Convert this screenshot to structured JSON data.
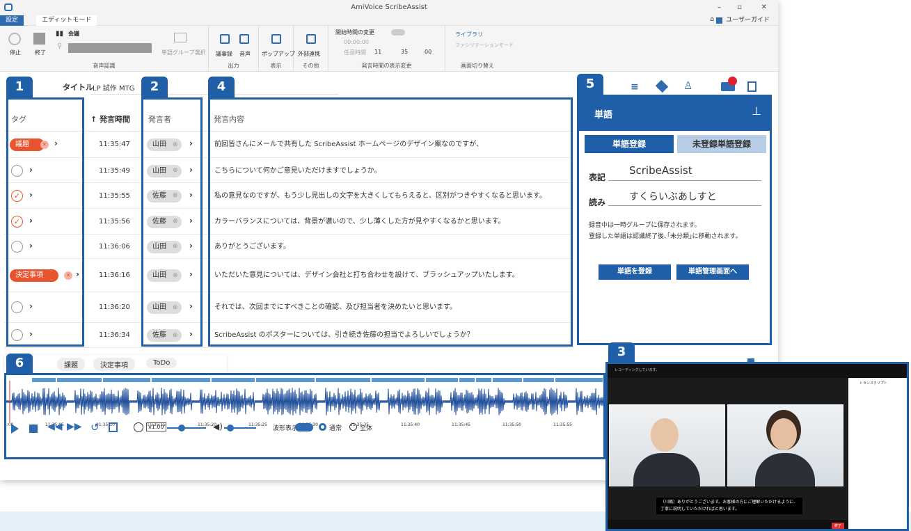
{
  "app": {
    "title": "AmiVoice ScribeAssist",
    "tabs": [
      "設定",
      "エディットモード"
    ],
    "user_guide": "ユーザーガイド"
  },
  "ribbon": {
    "speech": {
      "stop": "停止",
      "end": "終了",
      "meeting": "会議",
      "group": "音声認識",
      "word_group": "単語グループ選択"
    },
    "output": {
      "minutes": "議事録",
      "audio": "音声",
      "group": "出力"
    },
    "display": {
      "popup": "ポップアップ",
      "group": "表示"
    },
    "other": {
      "external": "外部連携",
      "group": "その他"
    },
    "time": {
      "start_change": "開始時間の変更",
      "time1": "00:00:00",
      "any_time": "任意時間",
      "h": "11",
      "m": "35",
      "s": "00",
      "group": "発言時間の表示変更"
    },
    "screen": {
      "library": "ライブラリ",
      "facilitation": "ファシリテーションモード",
      "group": "画面切り替え"
    }
  },
  "meeting": {
    "title_label": "タイトル",
    "title_value": "LP 試作 MTG"
  },
  "columns": {
    "tag": "タグ",
    "time": "↑ 発言時間",
    "speaker": "発言者",
    "content": "発言内容"
  },
  "rows": [
    {
      "tag": "議題",
      "time": "11:35:47",
      "speaker": "山田",
      "content": "前回皆さんにメールで共有した ScribeAssist ホームページのデザイン案なのですが、"
    },
    {
      "tag": "",
      "time": "11:35:49",
      "speaker": "山田",
      "content": "こちらについて何かご意見いただけますでしょうか。"
    },
    {
      "tag": "✓",
      "time": "11:35:55",
      "speaker": "佐藤",
      "content": "私の意見なのですが、もう少し見出しの文字を大きくしてもらえると、区別がつきやすくなると思います。"
    },
    {
      "tag": "✓",
      "time": "11:35:56",
      "speaker": "佐藤",
      "content": "カラーバランスについては、背景が濃いので、少し薄くした方が見やすくなるかと思います。"
    },
    {
      "tag": "",
      "time": "11:36:06",
      "speaker": "山田",
      "content": "ありがとうございます。"
    },
    {
      "tag": "決定事項",
      "time": "11:36:16",
      "speaker": "山田",
      "content": "いただいた意見については、デザイン会社と打ち合わせを設けて、ブラッシュアップいたします。"
    },
    {
      "tag": "",
      "time": "11:36:20",
      "speaker": "山田",
      "content": "それでは、次回までにすべきことの確認、及び担当者を決めたいと思います。"
    },
    {
      "tag": "",
      "time": "11:36:34",
      "speaker": "佐藤",
      "content": "ScribeAssist のポスターについては、引き続き佐藤の担当でよろしいでしょうか？"
    }
  ],
  "badges": [
    "1",
    "2",
    "3",
    "4",
    "5",
    "6"
  ],
  "word_panel": {
    "title": "単語",
    "tab_register": "単語登録",
    "tab_unregistered": "未登録単語登録",
    "notation_label": "表記",
    "notation_value": "ScribeAssist",
    "reading_label": "読み",
    "reading_value": "すくらいぶあしすと",
    "note1": "録音中は一時グループに保存されます。",
    "note2": "登録した単語は認識終了後､｢未分類｣に移動されます。",
    "btn_register": "単語を登録",
    "btn_manage": "単語管理画面へ"
  },
  "tag_filters": [
    "題",
    "課題",
    "決定事項",
    "ToDo"
  ],
  "wave": {
    "ticks": [
      "5:00",
      "11:35:05",
      "11:35:10",
      "11:35:15",
      "11:35:20",
      "11:35:25",
      "11:35:30",
      "11:35:35",
      "11:35:40",
      "11:35:45",
      "11:35:50",
      "11:35:55",
      "11:"
    ],
    "speed": "x1.00",
    "waveform_label": "波形表示",
    "normal": "通常",
    "all": "全体"
  },
  "video": {
    "recording": "レコーディングしています。",
    "transcript_title": "トランスクリプト",
    "subtitle": "（川嶋）ありがとうございます。お客様の方にご理解いただけるように、丁寧に説明していただければと思います。",
    "end": "終了"
  }
}
